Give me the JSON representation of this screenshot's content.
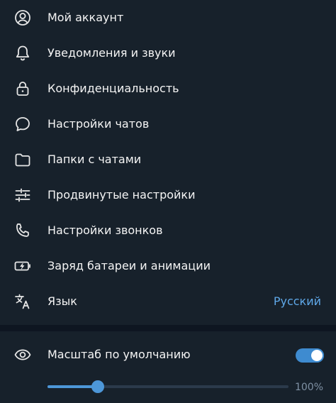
{
  "colors": {
    "background": "#17212b",
    "divider": "#0e1621",
    "accent": "#4d97d8",
    "link_value": "#5fa8e8",
    "icon": "#e6e6e6"
  },
  "menu": {
    "items": [
      {
        "label": "Мой аккаунт",
        "icon": "account-circle-icon"
      },
      {
        "label": "Уведомления и звуки",
        "icon": "bell-icon"
      },
      {
        "label": "Конфиденциальность",
        "icon": "lock-icon"
      },
      {
        "label": "Настройки чатов",
        "icon": "chat-bubble-icon"
      },
      {
        "label": "Папки с чатами",
        "icon": "folder-icon"
      },
      {
        "label": "Продвинутые настройки",
        "icon": "sliders-icon"
      },
      {
        "label": "Настройки звонков",
        "icon": "phone-icon"
      },
      {
        "label": "Заряд батареи и анимации",
        "icon": "battery-icon"
      },
      {
        "label": "Язык",
        "icon": "translate-icon",
        "value": "Русский"
      }
    ]
  },
  "scale": {
    "label": "Масштаб по умолчанию",
    "icon": "eye-icon",
    "toggle_on": true,
    "slider_fraction": 0.21,
    "value": "100%"
  }
}
